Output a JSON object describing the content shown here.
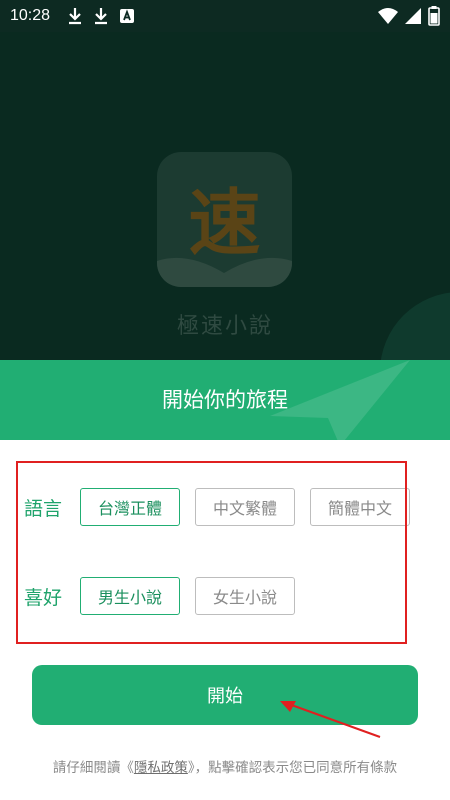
{
  "status_bar": {
    "time": "10:28",
    "left_icons": [
      "download-icon",
      "download-icon",
      "a-notification-icon"
    ],
    "right_icons": [
      "wifi-icon",
      "signal-icon",
      "battery-icon"
    ]
  },
  "splash": {
    "logo_char": "速",
    "app_name": "極速小說"
  },
  "header": {
    "title": "開始你的旅程"
  },
  "language": {
    "label": "語言",
    "options": [
      "台灣正體",
      "中文繁體",
      "簡體中文"
    ],
    "selected": "台灣正體"
  },
  "preference": {
    "label": "喜好",
    "options": [
      "男生小說",
      "女生小說"
    ],
    "selected": "男生小說"
  },
  "start_button": {
    "label": "開始"
  },
  "footer": {
    "prefix": "請仔細閱讀《",
    "policy_link": "隱私政策",
    "suffix": "》，點擊確認表示您已同意所有條款"
  },
  "colors": {
    "accent": "#21ae73",
    "splash_bg": "#0a2a20",
    "annotation_red": "#e02020"
  }
}
